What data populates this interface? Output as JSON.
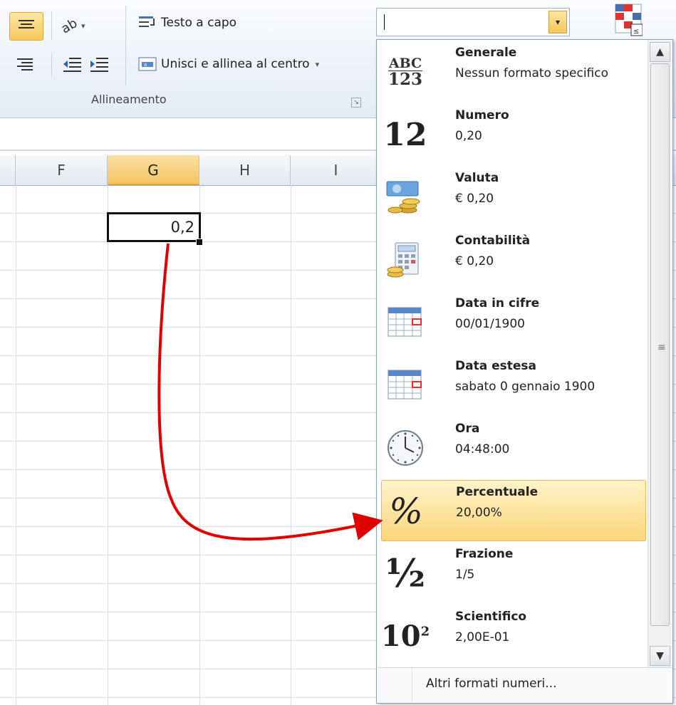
{
  "ribbon": {
    "wrap_text_label": "Testo a capo",
    "merge_center_label": "Unisci e allinea al centro",
    "merge_dropdown_glyph": "▾",
    "orientation_dropdown_glyph": "▾",
    "alignment_group_label": "Allineamento",
    "launcher_glyph": "↘",
    "number_format_value": "",
    "number_format_drop_glyph": "▾"
  },
  "sheet": {
    "columns": [
      "F",
      "G",
      "H",
      "I"
    ],
    "selected_column": "G",
    "active_cell_value": "0,2"
  },
  "number_format_menu": {
    "items": [
      {
        "name": "Generale",
        "sample": "Nessun formato specifico",
        "icon": "abc-123-icon"
      },
      {
        "name": "Numero",
        "sample": "0,20",
        "icon": "number-12-icon"
      },
      {
        "name": "Valuta",
        "sample": "€ 0,20",
        "icon": "currency-icon"
      },
      {
        "name": "Contabilità",
        "sample": "€ 0,20",
        "icon": "accounting-icon"
      },
      {
        "name": "Data in cifre",
        "sample": "00/01/1900",
        "icon": "calendar-icon"
      },
      {
        "name": "Data estesa",
        "sample": "sabato 0 gennaio 1900",
        "icon": "calendar-long-icon"
      },
      {
        "name": "Ora",
        "sample": "04:48:00",
        "icon": "clock-icon"
      },
      {
        "name": "Percentuale",
        "sample": "20,00%",
        "icon": "percent-icon",
        "selected": true
      },
      {
        "name": "Frazione",
        "sample": "1/5",
        "icon": "fraction-icon"
      },
      {
        "name": "Scientifico",
        "sample": "2,00E-01",
        "icon": "scientific-icon"
      }
    ],
    "glyphs": {
      "abc": "ABC",
      "n123": "123",
      "twelve": "12",
      "percent": "%",
      "half": "½",
      "ten": "10",
      "sup2": "2"
    },
    "more_formats_label": "Altri formati numeri...",
    "scroll_up_glyph": "▲",
    "scroll_down_glyph": "▼",
    "scroll_grip_glyph": "≡"
  },
  "colors": {
    "annotation_arrow": "#e00000",
    "selection_highlight": "#fbd67a"
  }
}
